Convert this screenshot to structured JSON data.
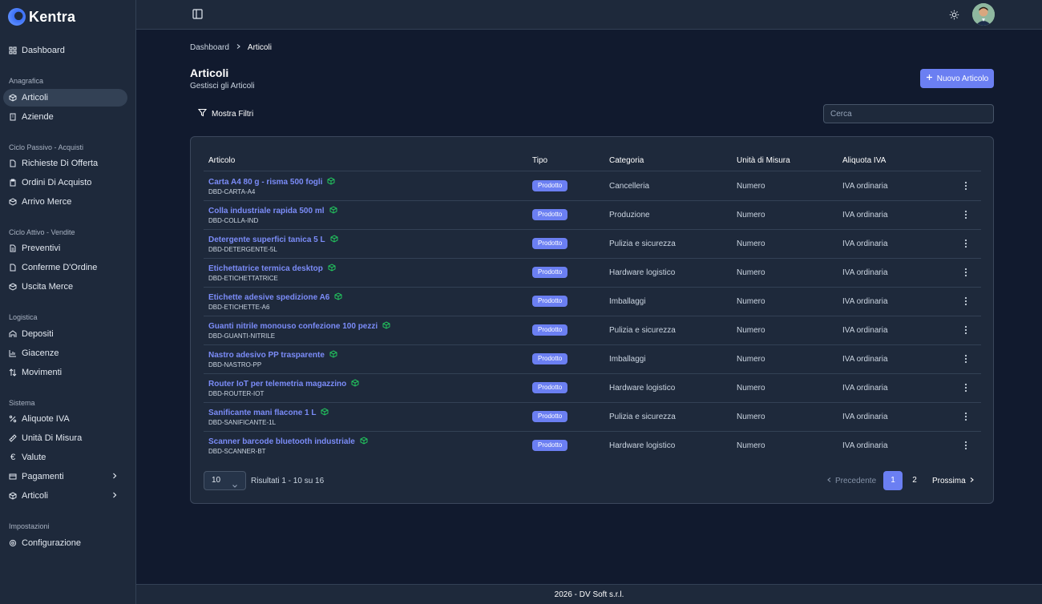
{
  "brand": {
    "name": "Kentra"
  },
  "sidebar": {
    "dashboard": "Dashboard",
    "groups": [
      {
        "label": "Anagrafica",
        "items": [
          "Articoli",
          "Aziende"
        ]
      },
      {
        "label": "Ciclo Passivo - Acquisti",
        "items": [
          "Richieste Di Offerta",
          "Ordini Di Acquisto",
          "Arrivo Merce"
        ]
      },
      {
        "label": "Ciclo Attivo - Vendite",
        "items": [
          "Preventivi",
          "Conferme D'Ordine",
          "Uscita Merce"
        ]
      },
      {
        "label": "Logistica",
        "items": [
          "Depositi",
          "Giacenze",
          "Movimenti"
        ]
      },
      {
        "label": "Sistema",
        "items": [
          "Aliquote IVA",
          "Unità Di Misura",
          "Valute",
          "Pagamenti",
          "Articoli"
        ]
      },
      {
        "label": "Impostazioni",
        "items": [
          "Configurazione"
        ]
      }
    ],
    "active_item": "Articoli"
  },
  "breadcrumb": {
    "home": "Dashboard",
    "current": "Articoli"
  },
  "page": {
    "title": "Articoli",
    "subtitle": "Gestisci gli Articoli"
  },
  "actions": {
    "new_button": "Nuovo Articolo",
    "filter_button": "Mostra Filtri"
  },
  "search": {
    "placeholder": "Cerca",
    "value": ""
  },
  "table": {
    "columns": [
      "Articolo",
      "Tipo",
      "Categoria",
      "Unità di Misura",
      "Aliquota IVA"
    ],
    "rows": [
      {
        "name": "Carta A4 80 g - risma 500 fogli",
        "code": "DBD-CARTA-A4",
        "tipo": "Prodotto",
        "categoria": "Cancelleria",
        "unita": "Numero",
        "iva": "IVA ordinaria"
      },
      {
        "name": "Colla industriale rapida 500 ml",
        "code": "DBD-COLLA-IND",
        "tipo": "Prodotto",
        "categoria": "Produzione",
        "unita": "Numero",
        "iva": "IVA ordinaria"
      },
      {
        "name": "Detergente superfici tanica 5 L",
        "code": "DBD-DETERGENTE-5L",
        "tipo": "Prodotto",
        "categoria": "Pulizia e sicurezza",
        "unita": "Numero",
        "iva": "IVA ordinaria"
      },
      {
        "name": "Etichettatrice termica desktop",
        "code": "DBD-ETICHETTATRICE",
        "tipo": "Prodotto",
        "categoria": "Hardware logistico",
        "unita": "Numero",
        "iva": "IVA ordinaria"
      },
      {
        "name": "Etichette adesive spedizione A6",
        "code": "DBD-ETICHETTE-A6",
        "tipo": "Prodotto",
        "categoria": "Imballaggi",
        "unita": "Numero",
        "iva": "IVA ordinaria"
      },
      {
        "name": "Guanti nitrile monouso confezione 100 pezzi",
        "code": "DBD-GUANTI-NITRILE",
        "tipo": "Prodotto",
        "categoria": "Pulizia e sicurezza",
        "unita": "Numero",
        "iva": "IVA ordinaria"
      },
      {
        "name": "Nastro adesivo PP trasparente",
        "code": "DBD-NASTRO-PP",
        "tipo": "Prodotto",
        "categoria": "Imballaggi",
        "unita": "Numero",
        "iva": "IVA ordinaria"
      },
      {
        "name": "Router IoT per telemetria magazzino",
        "code": "DBD-ROUTER-IOT",
        "tipo": "Prodotto",
        "categoria": "Hardware logistico",
        "unita": "Numero",
        "iva": "IVA ordinaria"
      },
      {
        "name": "Sanificante mani flacone 1 L",
        "code": "DBD-SANIFICANTE-1L",
        "tipo": "Prodotto",
        "categoria": "Pulizia e sicurezza",
        "unita": "Numero",
        "iva": "IVA ordinaria"
      },
      {
        "name": "Scanner barcode bluetooth industriale",
        "code": "DBD-SCANNER-BT",
        "tipo": "Prodotto",
        "categoria": "Hardware logistico",
        "unita": "Numero",
        "iva": "IVA ordinaria"
      }
    ]
  },
  "pagination": {
    "page_size": "10",
    "results": "Risultati 1 - 10 su 16",
    "prev": "Precedente",
    "next": "Prossima",
    "pages": [
      "1",
      "2"
    ],
    "current": "1"
  },
  "footer": {
    "text": "2026 - DV Soft s.r.l."
  },
  "colors": {
    "accent": "#6b7ff2",
    "link": "#7b8cf8",
    "product_icon": "#22c55e",
    "background": "#111a2e",
    "panel": "#1e293b"
  }
}
